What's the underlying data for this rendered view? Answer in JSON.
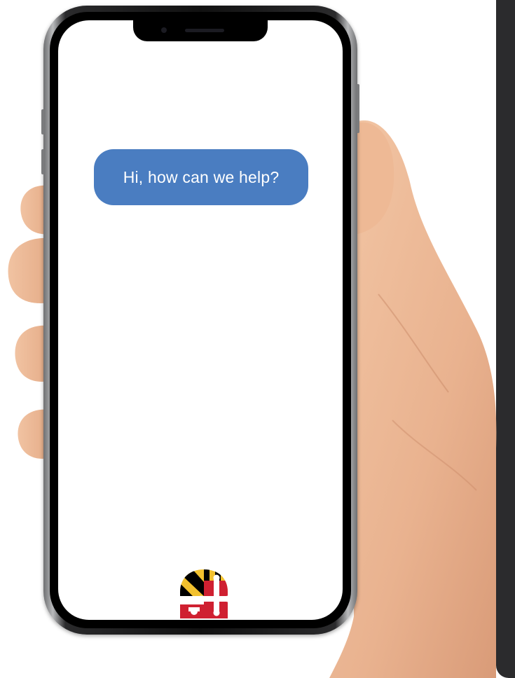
{
  "chat": {
    "message": "Hi, how can we help?",
    "bubble_color": "#4a7dc1",
    "text_color": "#ffffff"
  },
  "logo": {
    "icon": "maryland-flag-icon",
    "colors": [
      "#f2c12e",
      "#000000",
      "#cf2031",
      "#ffffff"
    ]
  },
  "device": {
    "type": "smartphone",
    "screen_color": "#ffffff"
  }
}
